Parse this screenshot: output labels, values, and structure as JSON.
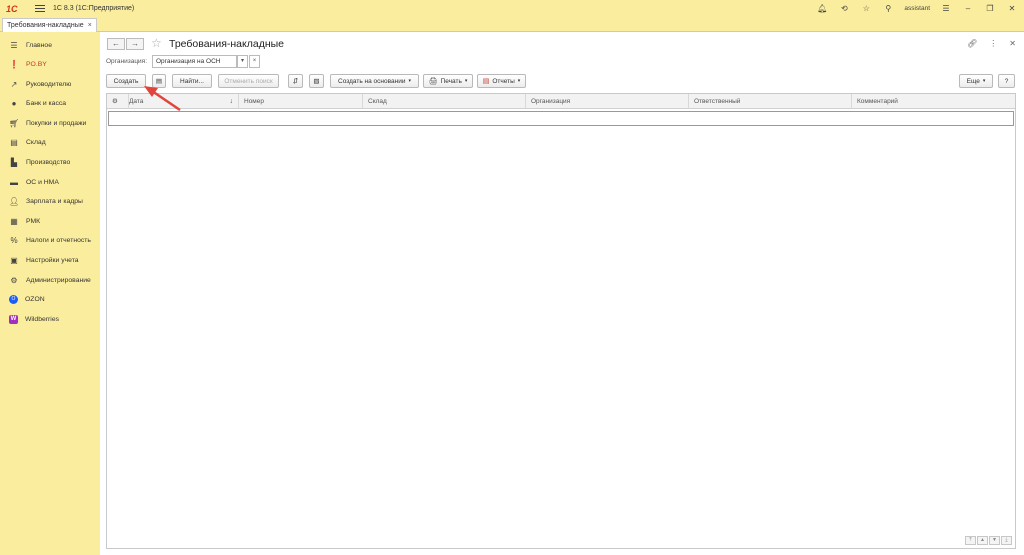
{
  "app": {
    "logo": "1С",
    "title": "1С 8.3  (1С:Предприятие)",
    "user": "assistant"
  },
  "tabs": [
    {
      "label": "Требования-накладные",
      "close": "×"
    }
  ],
  "sidebar": {
    "items": [
      {
        "label": "Главное",
        "icon": "menu-icon"
      },
      {
        "label": "PO.BY",
        "icon": "alert-icon"
      },
      {
        "label": "Руководителю",
        "icon": "chart-icon"
      },
      {
        "label": "Банк и касса",
        "icon": "bank-icon"
      },
      {
        "label": "Покупки и продажи",
        "icon": "cart-icon"
      },
      {
        "label": "Склад",
        "icon": "warehouse-icon"
      },
      {
        "label": "Производство",
        "icon": "factory-icon"
      },
      {
        "label": "ОС и НМА",
        "icon": "truck-icon"
      },
      {
        "label": "Зарплата и кадры",
        "icon": "person-icon"
      },
      {
        "label": "РМК",
        "icon": "register-icon"
      },
      {
        "label": "Налоги и отчетность",
        "icon": "tax-icon"
      },
      {
        "label": "Настройки учета",
        "icon": "settings-doc-icon"
      },
      {
        "label": "Администрирование",
        "icon": "gear-icon"
      },
      {
        "label": "OZON",
        "icon": "ozon-icon"
      },
      {
        "label": "Wildberries",
        "icon": "wildberries-icon"
      }
    ]
  },
  "main": {
    "title": "Требования-накладные",
    "org_label": "Организация:",
    "org_value": "Организация на ОСН",
    "toolbar": {
      "create": "Создать",
      "find": "Найти...",
      "cancel_search": "Отменить поиск",
      "create_based": "Создать на основании",
      "print": "Печать",
      "reports": "Отчеты",
      "more": "Еще",
      "help": "?"
    },
    "table": {
      "columns": [
        "Дата",
        "Номер",
        "Склад",
        "Организация",
        "Ответственный",
        "Комментарий"
      ],
      "rows": []
    }
  }
}
